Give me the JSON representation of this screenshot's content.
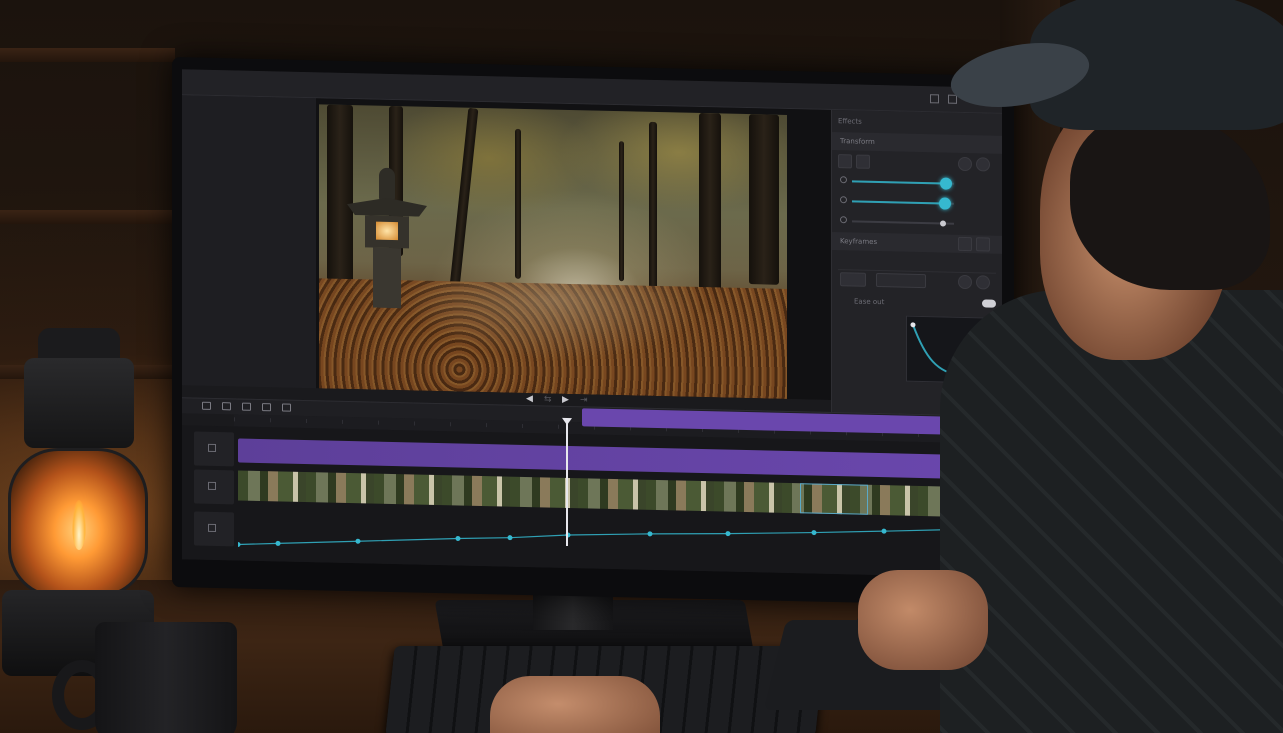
{
  "app": {
    "title": "",
    "window_controls": [
      "minimize-icon",
      "maximize-icon"
    ]
  },
  "viewer": {
    "scene": "misty forest path with stone lantern"
  },
  "panel": {
    "header": "Effects",
    "section_1": "Transform",
    "sliders": [
      {
        "name": "slider-1",
        "value": 0.9
      },
      {
        "name": "slider-2",
        "value": 0.89
      },
      {
        "name": "slider-3",
        "value": 0.86
      }
    ],
    "section_2": "Keyframes",
    "curve_label": "Ease out"
  },
  "transport": {
    "buttons": [
      "prev-frame-icon",
      "loop-icon",
      "play-icon",
      "next-frame-icon"
    ]
  },
  "timeline": {
    "tools": [
      "select-icon",
      "trim-icon",
      "razor-icon",
      "ripple-icon",
      "snap-icon"
    ],
    "playhead_position": 0.43,
    "keyframes_count": 14
  },
  "colors": {
    "accent": "#36b8cf",
    "clip_purple": "#6a47ad",
    "selection": "#5aa9c8",
    "panel_bg": "#232327",
    "timeline_bg": "#17171a"
  }
}
